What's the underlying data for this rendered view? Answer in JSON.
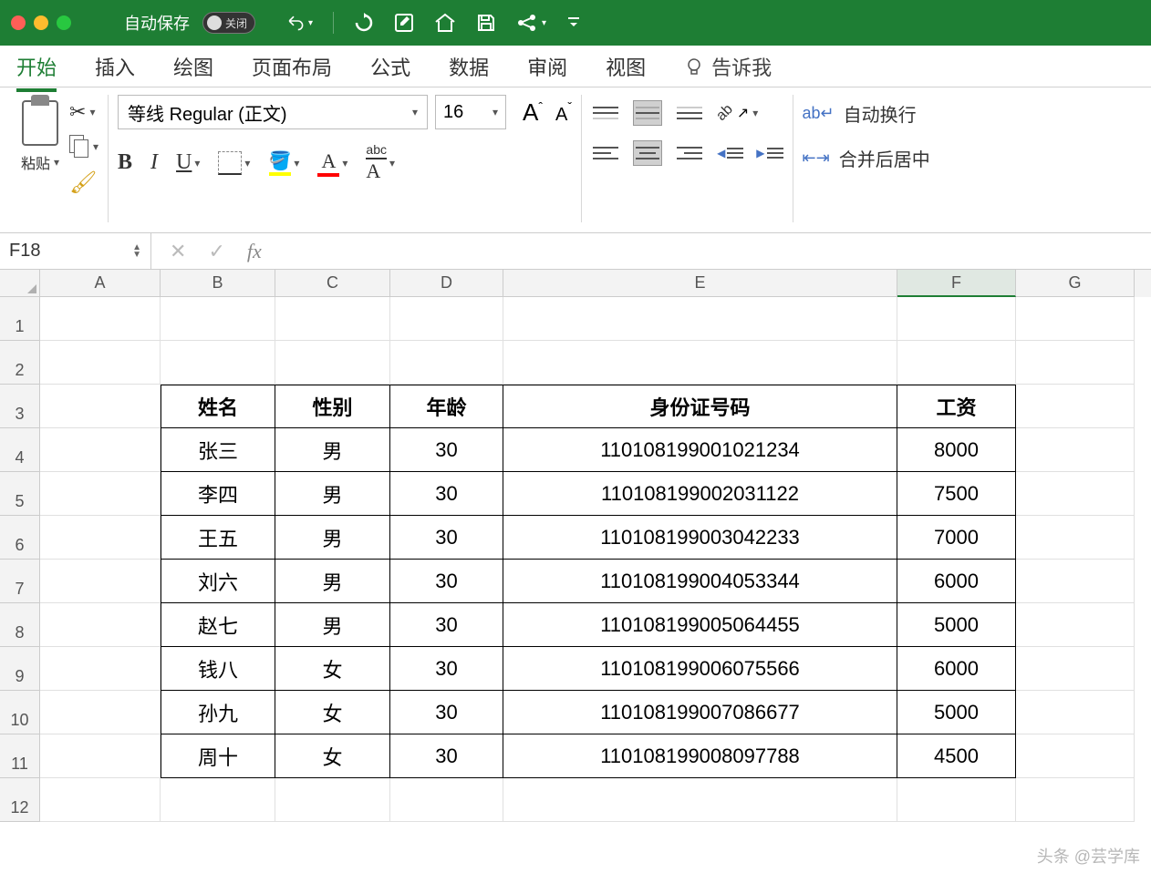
{
  "titlebar": {
    "autosave_label": "自动保存",
    "autosave_state": "关闭"
  },
  "ribbon_tabs": {
    "home": "开始",
    "insert": "插入",
    "draw": "绘图",
    "page_layout": "页面布局",
    "formulas": "公式",
    "data": "数据",
    "review": "审阅",
    "view": "视图",
    "tell_me": "告诉我"
  },
  "ribbon": {
    "paste": "粘贴",
    "font_name": "等线 Regular (正文)",
    "font_size": "16",
    "bold": "B",
    "italic": "I",
    "underline": "U",
    "phonetic": "abc",
    "font_letter": "A",
    "wrap_text": "自动换行",
    "merge": "合并后居中"
  },
  "formula_bar": {
    "cell_ref": "F18",
    "fx": "fx",
    "value": ""
  },
  "columns": [
    "A",
    "B",
    "C",
    "D",
    "E",
    "F",
    "G"
  ],
  "rows": [
    "1",
    "2",
    "3",
    "4",
    "5",
    "6",
    "7",
    "8",
    "9",
    "10",
    "11",
    "12"
  ],
  "active_column": "F",
  "table": {
    "headers": {
      "name": "姓名",
      "gender": "性别",
      "age": "年龄",
      "id_no": "身份证号码",
      "salary": "工资"
    },
    "rows": [
      {
        "name": "张三",
        "gender": "男",
        "age": "30",
        "id": "110108199001021234",
        "salary": "8000"
      },
      {
        "name": "李四",
        "gender": "男",
        "age": "30",
        "id": "110108199002031122",
        "salary": "7500"
      },
      {
        "name": "王五",
        "gender": "男",
        "age": "30",
        "id": "110108199003042233",
        "salary": "7000"
      },
      {
        "name": "刘六",
        "gender": "男",
        "age": "30",
        "id": "110108199004053344",
        "salary": "6000"
      },
      {
        "name": "赵七",
        "gender": "男",
        "age": "30",
        "id": "110108199005064455",
        "salary": "5000"
      },
      {
        "name": "钱八",
        "gender": "女",
        "age": "30",
        "id": "110108199006075566",
        "salary": "6000"
      },
      {
        "name": "孙九",
        "gender": "女",
        "age": "30",
        "id": "110108199007086677",
        "salary": "5000"
      },
      {
        "name": "周十",
        "gender": "女",
        "age": "30",
        "id": "110108199008097788",
        "salary": "4500"
      }
    ]
  },
  "watermark": "头条 @芸学库"
}
